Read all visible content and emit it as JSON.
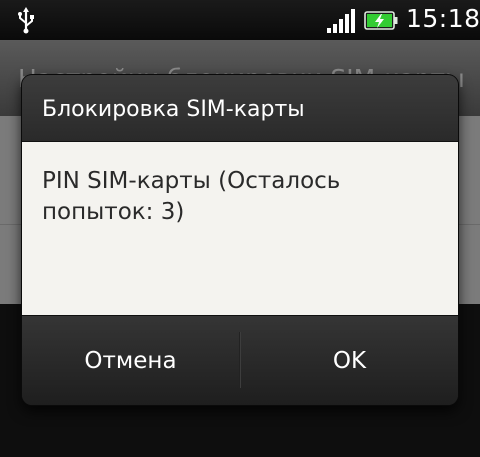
{
  "status_bar": {
    "time": "15:18",
    "icons": [
      "usb-icon",
      "signal-icon",
      "battery-charging-icon"
    ],
    "battery_color": "#33cc33"
  },
  "background": {
    "title": "Настройки блокировки SIM-карты"
  },
  "dialog": {
    "title": "Блокировка SIM-карты",
    "message": "PIN SIM-карты (Осталось попыток: 3)",
    "pin_value": "",
    "cancel_label": "Отмена",
    "ok_label": "OK",
    "accent_color": "#9fb069"
  }
}
